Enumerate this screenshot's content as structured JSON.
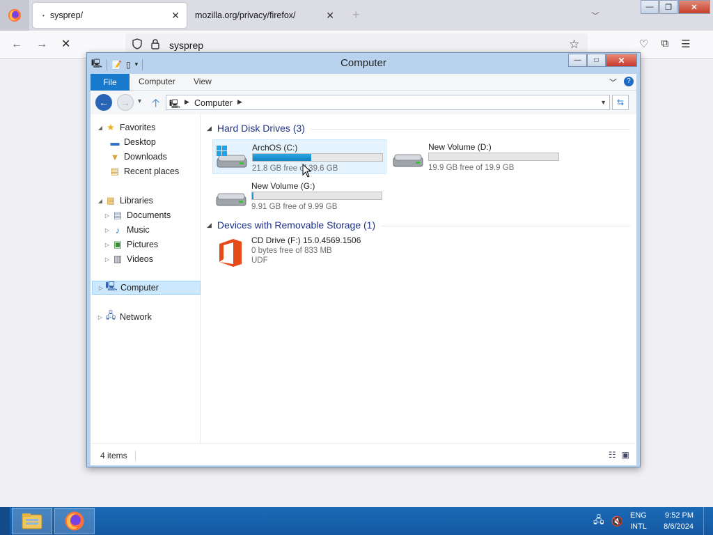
{
  "browser": {
    "tabs": [
      {
        "title": "sysprep/",
        "close": "✕"
      },
      {
        "title": "mozilla.org/privacy/firefox/",
        "close": "✕"
      }
    ],
    "new_tab_icon": "+",
    "tabs_list_icon": "﹀",
    "url": "sysprep",
    "window_controls": {
      "minimize": "—",
      "restore": "❐",
      "close": "✕"
    },
    "nav": {
      "back": "←",
      "forward": "→",
      "stop": "✕"
    },
    "icons": [
      "shield-icon",
      "lock-icon",
      "star-icon",
      "pocket-icon",
      "extensions-icon",
      "menu-icon"
    ]
  },
  "explorer": {
    "title": "Computer",
    "ribbon_tabs": {
      "file": "File",
      "computer": "Computer",
      "view": "View"
    },
    "address": {
      "location": "Computer"
    },
    "navigation": {
      "favorites": {
        "label": "Favorites",
        "items": [
          "Desktop",
          "Downloads",
          "Recent places"
        ]
      },
      "libraries": {
        "label": "Libraries",
        "items": [
          "Documents",
          "Music",
          "Pictures",
          "Videos"
        ]
      },
      "computer": "Computer",
      "network": "Network"
    },
    "groups": {
      "hard_disks": {
        "title": "Hard Disk Drives (3)",
        "drives": [
          {
            "name": "ArchOS (C:)",
            "free": "21.8 GB free of 39.6 GB",
            "used_fraction": 0.45
          },
          {
            "name": "New Volume (D:)",
            "free": "19.9 GB free of 19.9 GB",
            "used_fraction": 0.0
          },
          {
            "name": "New Volume (G:)",
            "free": "9.91 GB free of 9.99 GB",
            "used_fraction": 0.01
          }
        ]
      },
      "removable": {
        "title": "Devices with Removable Storage (1)",
        "drives": [
          {
            "name": "CD Drive (F:) 15.0.4569.1506",
            "free": "0 bytes free of 833 MB",
            "fs": "UDF"
          }
        ]
      }
    },
    "status": {
      "items": "4 items"
    },
    "colors": {
      "bar_fill": "#1a8fd2",
      "selection": "#cce8ff",
      "group_header": "#1e3287",
      "ribbon_file": "#1979ca"
    }
  },
  "taskbar": {
    "apps": [
      "file-explorer-icon",
      "firefox-icon"
    ],
    "language": {
      "code": "ENG",
      "layout": "INTL"
    },
    "clock": {
      "time": "9:52 PM",
      "date": "8/6/2024"
    }
  }
}
